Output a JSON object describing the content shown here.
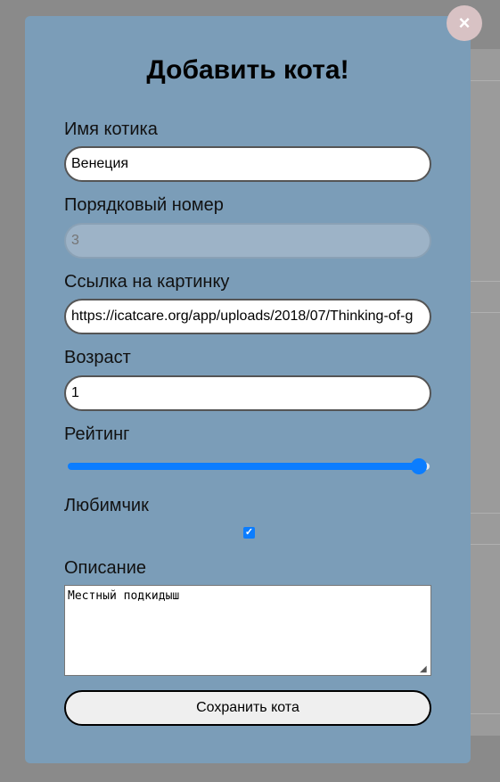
{
  "modal": {
    "title": "Добавить кота!",
    "close_label": "×"
  },
  "form": {
    "name": {
      "label": "Имя котика",
      "value": "Венеция"
    },
    "id": {
      "label": "Порядковый номер",
      "placeholder": "3"
    },
    "image": {
      "label": "Ссылка на картинку",
      "value": "https://icatcare.org/app/uploads/2018/07/Thinking-of-g"
    },
    "age": {
      "label": "Возраст",
      "value": "1"
    },
    "rating": {
      "label": "Рейтинг",
      "level_fraction": 0.97
    },
    "favorite": {
      "label": "Любимчик",
      "checked": true
    },
    "description": {
      "label": "Описание",
      "value": "Местный подкидыш"
    },
    "save_label": "Сохранить кота"
  }
}
